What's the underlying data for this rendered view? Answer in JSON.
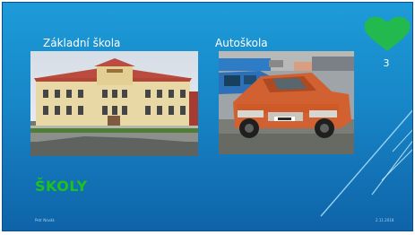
{
  "slide": {
    "caption_left": "Základní škola",
    "caption_right": "Autoškola",
    "counter": "3",
    "title": "ŠKOLY",
    "footer_left": "Petr Novák",
    "footer_right": "2.11.2018"
  },
  "icons": {
    "heart": "heart-icon"
  },
  "colors": {
    "background_top": "#1d9bd8",
    "background_bottom": "#0f63a8",
    "heart": "#22b94e",
    "title": "#1dc21d"
  }
}
